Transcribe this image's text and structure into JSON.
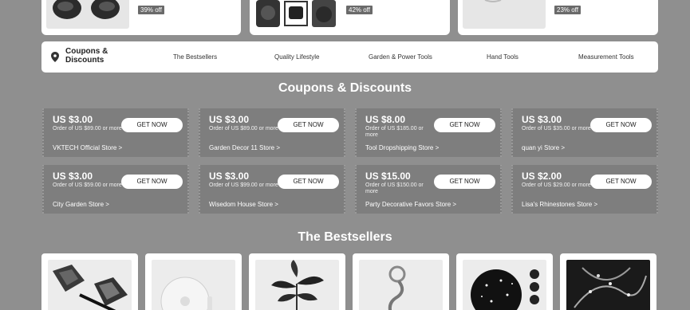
{
  "top_cards": [
    {
      "badge": "39% off"
    },
    {
      "badge": "42% off"
    },
    {
      "badge": "23% off"
    }
  ],
  "nav": {
    "items": [
      "Coupons & Discounts",
      "The Bestsellers",
      "Quality Lifestyle",
      "Garden & Power Tools",
      "Hand Tools",
      "Measurement Tools"
    ]
  },
  "coupons_section": {
    "title": "Coupons & Discounts",
    "button_label": "GET NOW",
    "coupons": [
      {
        "amount": "US $3.00",
        "condition": "Order of US $89.00 or more",
        "store": "VKTECH Official Store >"
      },
      {
        "amount": "US $3.00",
        "condition": "Order of US $89.00 or more",
        "store": "Garden Decor 11 Store >"
      },
      {
        "amount": "US $8.00",
        "condition": "Order of US $185.00 or more",
        "store": "Tool Dropshipping Store >"
      },
      {
        "amount": "US $3.00",
        "condition": "Order of US $35.00 or more",
        "store": "quan yi Store >"
      },
      {
        "amount": "US $3.00",
        "condition": "Order of US $59.00 or more",
        "store": "City Garden Store >"
      },
      {
        "amount": "US $3.00",
        "condition": "Order of US $99.00 or more",
        "store": "Wisedom House Store >"
      },
      {
        "amount": "US $15.00",
        "condition": "Order of US $150.00 or more",
        "store": "Party Decorative Favors Store >"
      },
      {
        "amount": "US $2.00",
        "condition": "Order of US $29.00 or more",
        "store": "Lisa's Rhinestones Store >"
      }
    ]
  },
  "bestsellers_section": {
    "title": "The Bestsellers",
    "products": [
      {
        "icon": "garden-bag-icon"
      },
      {
        "icon": "round-lamp-icon"
      },
      {
        "icon": "potted-plant-icon"
      },
      {
        "icon": "flexible-lamp-icon"
      },
      {
        "icon": "star-projector-icon"
      },
      {
        "icon": "light-string-icon"
      }
    ]
  }
}
